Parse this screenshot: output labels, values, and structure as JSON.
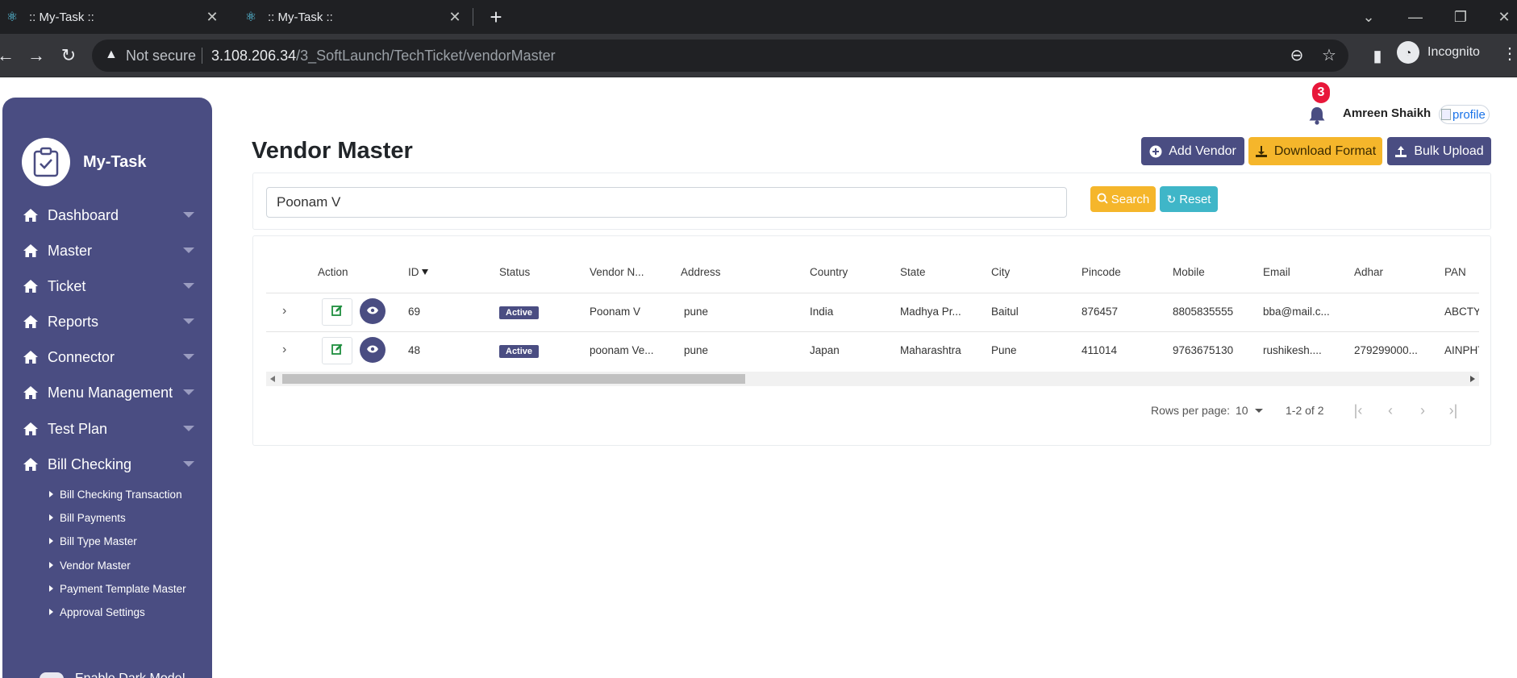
{
  "browser": {
    "tabs": [
      {
        "title": ":: My-Task ::"
      },
      {
        "title": ":: My-Task ::"
      }
    ],
    "address": {
      "security_label": "Not secure",
      "host": "3.108.206.34",
      "path": "/3_SoftLaunch/TechTicket/vendorMaster"
    },
    "profile_label": "Incognito"
  },
  "sidebar": {
    "brand": "My-Task",
    "items": [
      {
        "label": "Dashboard"
      },
      {
        "label": "Master"
      },
      {
        "label": "Ticket"
      },
      {
        "label": "Reports"
      },
      {
        "label": "Connector"
      },
      {
        "label": "Menu Management"
      },
      {
        "label": "Test Plan"
      },
      {
        "label": "Bill Checking"
      }
    ],
    "sub_items": [
      {
        "label": "Bill Checking Transaction"
      },
      {
        "label": "Bill Payments"
      },
      {
        "label": "Bill Type Master"
      },
      {
        "label": "Vendor Master"
      },
      {
        "label": "Payment Template Master"
      },
      {
        "label": "Approval Settings"
      }
    ],
    "dark_mode_label": "Enable Dark Mode!"
  },
  "header": {
    "notification_count": "3",
    "user_name": "Amreen Shaikh",
    "profile_alt": "profile"
  },
  "page": {
    "title": "Vendor Master",
    "actions": {
      "add": "Add Vendor",
      "download": "Download Format",
      "bulk": "Bulk Upload"
    }
  },
  "search": {
    "value": "Poonam V",
    "search_label": "Search",
    "reset_label": "Reset"
  },
  "table": {
    "columns": [
      "Action",
      "ID",
      "Status",
      "Vendor N...",
      "Address",
      "Country",
      "State",
      "City",
      "Pincode",
      "Mobile",
      "Email",
      "Adhar",
      "PAN"
    ],
    "rows": [
      {
        "id": "69",
        "status": "Active",
        "vendor": "Poonam V",
        "address": "pune",
        "country": "India",
        "state": "Madhya Pr...",
        "city": "Baitul",
        "pincode": "876457",
        "mobile": "8805835555",
        "email": "bba@mail.c...",
        "adhar": "",
        "pan": "ABCTYU"
      },
      {
        "id": "48",
        "status": "Active",
        "vendor": "poonam Ve...",
        "address": "pune",
        "country": "Japan",
        "state": "Maharashtra",
        "city": "Pune",
        "pincode": "411014",
        "mobile": "9763675130",
        "email": "rushikesh....",
        "adhar": "279299000...",
        "pan": "AINPHT"
      }
    ],
    "pagination": {
      "rows_per_page_label": "Rows per page:",
      "rows_per_page": "10",
      "range": "1-2 of 2"
    }
  },
  "colors": {
    "primary": "#4a4d82",
    "warning": "#f5b62b",
    "info": "#3fb6c8",
    "badge_red": "#e8173a"
  }
}
